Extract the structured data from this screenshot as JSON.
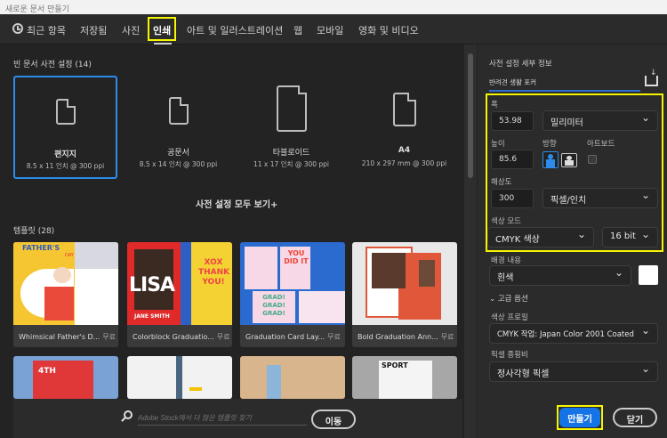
{
  "window": {
    "title": "새로운 문서 만들기"
  },
  "tabs": [
    {
      "label": "최근 항목",
      "icon": "clock-icon"
    },
    {
      "label": "저장됨"
    },
    {
      "label": "사진"
    },
    {
      "label": "인쇄",
      "active": true
    },
    {
      "label": "아트 및 일러스트레이션"
    },
    {
      "label": "웹"
    },
    {
      "label": "모바일"
    },
    {
      "label": "영화 및 비디오"
    }
  ],
  "presets": {
    "heading": "빈 문서 사전 설정 (14)",
    "items": [
      {
        "name": "편지지",
        "size": "8.5 x 11 인치 @ 300 ppi",
        "selected": true
      },
      {
        "name": "공문서",
        "size": "8.5 x 14 인치 @ 300 ppi"
      },
      {
        "name": "타블로이드",
        "size": "11 x 17 인치 @ 300 ppi"
      },
      {
        "name": "A4",
        "size": "210 x 297 mm @ 300 ppi"
      }
    ],
    "view_all": "사전 설정 모두 보기+"
  },
  "templates": {
    "heading": "템플릿 (28)",
    "items": [
      {
        "title": "Whimsical Father's D...",
        "badge": "무료"
      },
      {
        "title": "Colorblock Graduatio...",
        "badge": "무료"
      },
      {
        "title": "Graduation Card Lay...",
        "badge": "무료"
      },
      {
        "title": "Bold Graduation Ann...",
        "badge": "무료"
      }
    ],
    "thumb_text": {
      "fathers": "FATHER'S",
      "day": "DAY",
      "lisa": "LISA",
      "jane": "JANE SMITH",
      "xox": "XOX THANK YOU!",
      "youdidit": "YOU DID IT",
      "grad": "GRAD! GRAD! GRAD!",
      "fourth": "4TH",
      "sport": "SPORT"
    }
  },
  "search": {
    "placeholder": "Adobe Stock에서 더 많은 템플릿 찾기",
    "go": "이동"
  },
  "details": {
    "heading": "사전 설정 세부 정보",
    "name": "반려견 생활 포커",
    "width_label": "폭",
    "width": "53.98",
    "unit": "밀리미터",
    "height_label": "높이",
    "height": "85.6",
    "orientation_label": "방향",
    "artboard_label": "아트보드",
    "resolution_label": "해상도",
    "resolution": "300",
    "resolution_unit": "픽셀/인치",
    "color_mode_label": "색상 모드",
    "color_mode": "CMYK 색상",
    "bit_depth": "16 bit",
    "background_label": "배경 내용",
    "background": "흰색",
    "background_color": "#ffffff",
    "advanced": "고급 옵션",
    "profile_label": "색상 프로필",
    "profile": "CMYK 작업: Japan Color 2001 Coated",
    "aspect_label": "픽셀 종횡비",
    "aspect": "정사각형 픽셀"
  },
  "buttons": {
    "create": "만들기",
    "close": "닫기"
  },
  "colors": {
    "accent": "#1473e6",
    "highlight": "#f5f500",
    "selected_border": "#2d8ceb"
  }
}
